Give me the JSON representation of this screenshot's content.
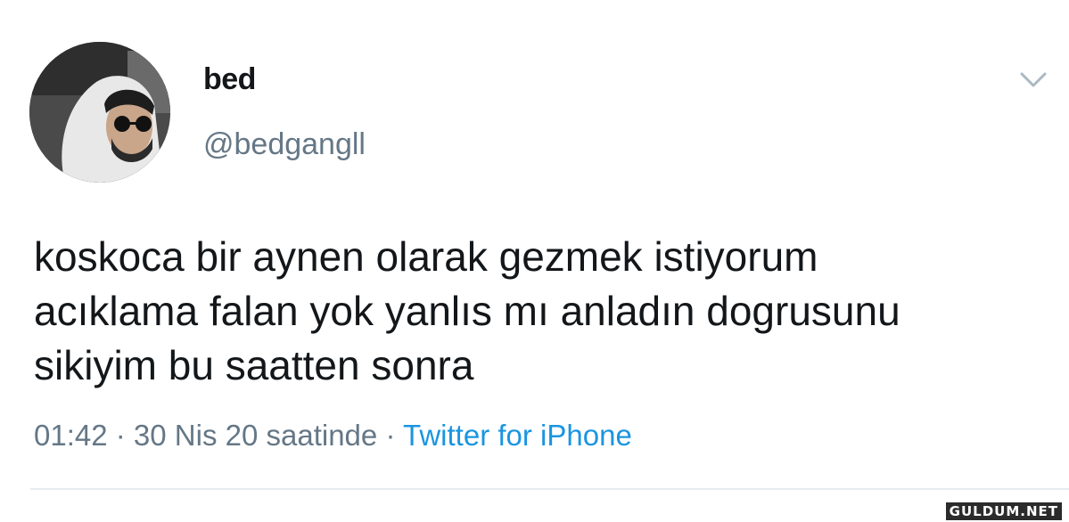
{
  "user": {
    "display_name": "bed",
    "handle": "@bedgangll"
  },
  "tweet": {
    "text_lines": [
      "koskoca bir aynen olarak gezmek istiyorum",
      "acıklama falan yok yanlıs mı anladın dogrusunu",
      "sikiyim bu saatten sonra"
    ],
    "time": "01:42",
    "date": "30 Nis 20 saatinde",
    "separator": " · ",
    "source": "Twitter for iPhone"
  },
  "icons": {
    "more": "chevron-down-icon"
  },
  "colors": {
    "text": "#14171a",
    "secondary": "#657786",
    "link": "#1b95e0",
    "divider": "#e6ecf0"
  },
  "watermark": "GULDUM.NET"
}
